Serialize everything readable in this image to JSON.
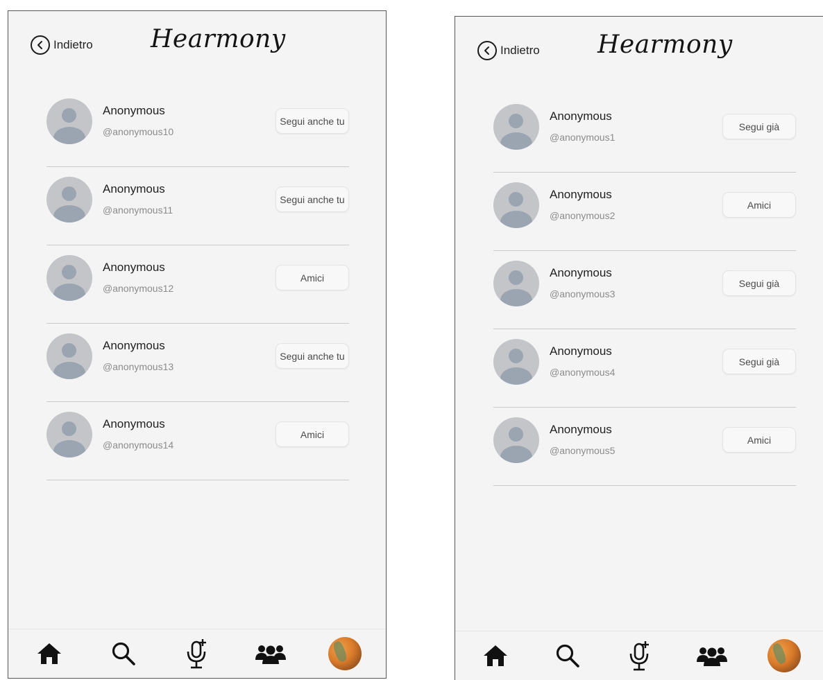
{
  "screens": [
    {
      "header": {
        "back_label": "Indietro",
        "title": "Hearmony"
      },
      "users": [
        {
          "name": "Anonymous",
          "handle": "@anonymous10",
          "action": "Segui anche tu"
        },
        {
          "name": "Anonymous",
          "handle": "@anonymous11",
          "action": "Segui anche tu"
        },
        {
          "name": "Anonymous",
          "handle": "@anonymous12",
          "action": "Amici"
        },
        {
          "name": "Anonymous",
          "handle": "@anonymous13",
          "action": "Segui anche tu"
        },
        {
          "name": "Anonymous",
          "handle": "@anonymous14",
          "action": "Amici"
        }
      ]
    },
    {
      "header": {
        "back_label": "Indietro",
        "title": "Hearmony"
      },
      "users": [
        {
          "name": "Anonymous",
          "handle": "@anonymous1",
          "action": "Segui già"
        },
        {
          "name": "Anonymous",
          "handle": "@anonymous2",
          "action": "Amici"
        },
        {
          "name": "Anonymous",
          "handle": "@anonymous3",
          "action": "Segui già"
        },
        {
          "name": "Anonymous",
          "handle": "@anonymous4",
          "action": "Segui già"
        },
        {
          "name": "Anonymous",
          "handle": "@anonymous5",
          "action": "Amici"
        }
      ]
    }
  ],
  "nav": {
    "items": [
      {
        "icon": "home-icon"
      },
      {
        "icon": "search-icon"
      },
      {
        "icon": "microphone-add-icon"
      },
      {
        "icon": "friends-icon"
      },
      {
        "icon": "profile-avatar"
      }
    ]
  },
  "colors": {
    "screen_bg": "#f4f4f4",
    "avatar_bg": "#c4c5c8",
    "avatar_figure": "#9aa5b1",
    "divider": "#c9c9c9",
    "button_bg": "#f8f8f8"
  }
}
